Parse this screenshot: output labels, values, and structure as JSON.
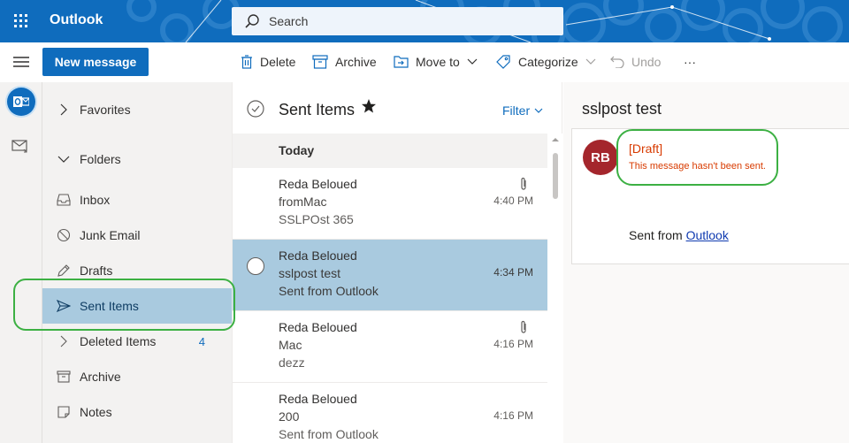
{
  "header": {
    "app_title": "Outlook",
    "search_placeholder": "Search"
  },
  "toolbar": {
    "new_message": "New message",
    "delete": "Delete",
    "archive": "Archive",
    "move_to": "Move to",
    "categorize": "Categorize",
    "undo": "Undo",
    "more": "···"
  },
  "folders": {
    "favorites": "Favorites",
    "folders": "Folders",
    "items": [
      {
        "label": "Inbox",
        "icon": "inbox-icon"
      },
      {
        "label": "Junk Email",
        "icon": "junk-icon"
      },
      {
        "label": "Drafts",
        "icon": "pencil-icon"
      },
      {
        "label": "Sent Items",
        "icon": "send-icon",
        "selected": true
      },
      {
        "label": "Deleted Items",
        "icon": "chevron-right-icon",
        "count": "4"
      },
      {
        "label": "Archive",
        "icon": "archive-icon"
      },
      {
        "label": "Notes",
        "icon": "note-icon"
      }
    ]
  },
  "message_list": {
    "title": "Sent Items",
    "filter": "Filter",
    "group": "Today",
    "messages": [
      {
        "sender": "Reda Beloued",
        "subject": "fromMac",
        "preview": "SSLPOst 365",
        "time": "4:40 PM",
        "attachment": true
      },
      {
        "sender": "Reda Beloued",
        "subject": "sslpost test",
        "preview": "Sent from Outlook",
        "time": "4:34 PM",
        "attachment": false,
        "selected": true
      },
      {
        "sender": "Reda Beloued",
        "subject": "Mac",
        "preview": "dezz",
        "time": "4:16 PM",
        "attachment": true
      },
      {
        "sender": "Reda Beloued",
        "subject": "200",
        "preview": "Sent from Outlook",
        "time": "4:16 PM",
        "attachment": false
      }
    ]
  },
  "reading_pane": {
    "subject": "sslpost test",
    "avatar_initials": "RB",
    "draft_label": "[Draft]",
    "not_sent": "This message hasn't been sent.",
    "body_prefix": "Sent from ",
    "body_link": "Outlook"
  },
  "colors": {
    "brand": "#0f6cbd",
    "selected": "#a9cadf",
    "avatar": "#a4262c",
    "draft_text": "#d83b01",
    "annotation": "#3cb043"
  }
}
